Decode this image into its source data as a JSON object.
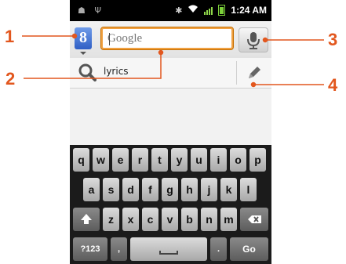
{
  "status_bar": {
    "time": "1:24 AM",
    "left_icons": [
      "android-debug-icon",
      "usb-icon"
    ],
    "right_icons": [
      "bluetooth-icon",
      "wifi-icon",
      "signal-icon",
      "battery-icon"
    ]
  },
  "search": {
    "placeholder": "Google",
    "provider_icon_letter": "8"
  },
  "suggestions": [
    {
      "text": "lyrics"
    }
  ],
  "callouts": [
    "1",
    "2",
    "3",
    "4"
  ],
  "keyboard": {
    "row1": [
      "q",
      "w",
      "e",
      "r",
      "t",
      "y",
      "u",
      "i",
      "o",
      "p"
    ],
    "row2": [
      "a",
      "s",
      "d",
      "f",
      "g",
      "h",
      "j",
      "k",
      "l"
    ],
    "row3": [
      "z",
      "x",
      "c",
      "v",
      "b",
      "n",
      "m"
    ],
    "symbols_label": "?123",
    "comma_label": ",",
    "period_label": ".",
    "go_label": "Go"
  },
  "colors": {
    "callout_line": "#e2571e",
    "focus_border": "#f0a040",
    "search_button_blue": "#2f5fc5"
  }
}
